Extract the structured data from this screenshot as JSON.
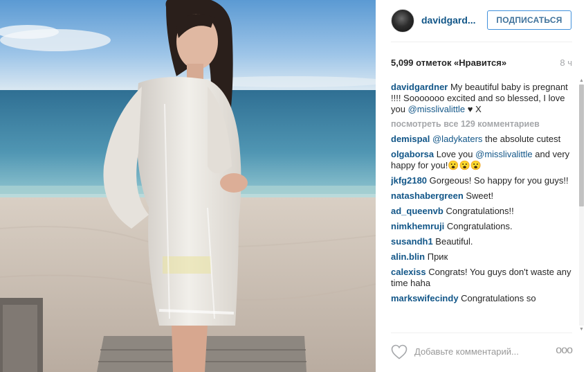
{
  "header": {
    "username": "davidgard...",
    "follow_label": "ПОДПИСАТЬСЯ"
  },
  "stats": {
    "likes": "5,099 отметок «Нравится»",
    "time": "8 ч"
  },
  "caption": {
    "user": "davidgardner",
    "text_before": " My beautiful baby is pregnant !!!! Sooooooo excited and so blessed, I love you ",
    "mention": "@misslivalittle",
    "text_after": " ♥ X"
  },
  "view_all": "посмотреть все 129 комментариев",
  "comments": [
    {
      "user": "demispal",
      "mention": "@ladykaters",
      "text": " the absolute cutest"
    },
    {
      "user": "olgaborsa",
      "pre": " Love you ",
      "mention": "@misslivalittle",
      "text": " and very happy for you!😮😮😮"
    },
    {
      "user": "jkfg2180",
      "text": " Gorgeous! So happy for you guys!!"
    },
    {
      "user": "natashabergreen",
      "text": " Sweet!"
    },
    {
      "user": "ad_queenvb",
      "text": " Congratulations!!"
    },
    {
      "user": "nimkhemruji",
      "text": " Congratulations."
    },
    {
      "user": "susandh1",
      "text": " Beautiful."
    },
    {
      "user": "alin.blin",
      "text": " Прик"
    },
    {
      "user": "calexiss",
      "text": " Congrats! You guys don't waste any time haha"
    },
    {
      "user": "markswifecindy",
      "text": " Congratulations so"
    }
  ],
  "footer": {
    "add_comment_placeholder": "Добавьте комментарий...",
    "more_label": "ooo"
  },
  "icons": {
    "heart": "heart-icon",
    "more": "more-options-icon"
  },
  "colors": {
    "link": "#125688",
    "button_border": "#4090db",
    "muted": "#a5a7aa"
  }
}
